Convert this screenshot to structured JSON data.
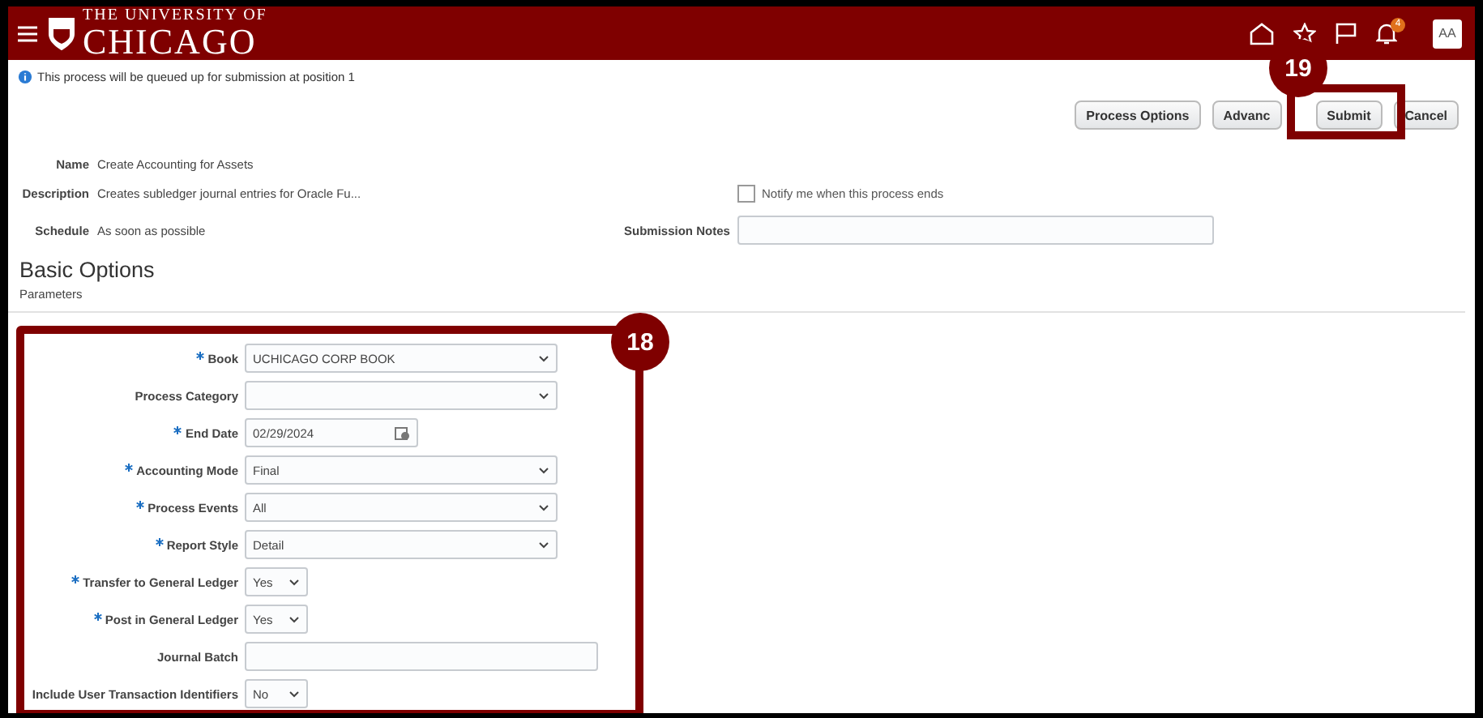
{
  "header": {
    "logo_top": "THE UNIVERSITY OF",
    "logo_main": "CHICAGO",
    "notification_count": "4",
    "avatar": "AA"
  },
  "info_message": "This process will be queued up for submission at position 1",
  "buttons": [
    {
      "label": "Process Options"
    },
    {
      "label": "Advanc"
    },
    {
      "label": "Submit"
    },
    {
      "label": "Cancel"
    }
  ],
  "details": [
    {
      "label": "Name",
      "value": "Create Accounting for Assets"
    },
    {
      "label": "Description",
      "value": "Creates subledger journal entries for Oracle Fu..."
    },
    {
      "label": "Schedule",
      "value": "As soon as possible"
    }
  ],
  "notify": {
    "label": "Notify me when this process ends",
    "checked": false
  },
  "submission_notes": {
    "label": "Submission Notes"
  },
  "section_title": "Basic Options",
  "subsection": "Parameters",
  "parameters": [
    {
      "label": "Book",
      "required": true,
      "kind": "select",
      "value": "UCHICAGO CORP BOOK"
    },
    {
      "label": "Process Category",
      "required": false,
      "kind": "select"
    },
    {
      "label": "End Date",
      "required": true,
      "kind": "date",
      "value": "02/29/2024"
    },
    {
      "label": "Accounting Mode",
      "required": true,
      "kind": "select",
      "value": "Final"
    },
    {
      "label": "Process Events",
      "required": true,
      "kind": "select",
      "value": "All"
    },
    {
      "label": "Report Style",
      "required": true,
      "kind": "select",
      "value": "Detail"
    },
    {
      "label": "Transfer to General Ledger",
      "required": true,
      "kind": "toggle",
      "value": "Yes"
    },
    {
      "label": "Post in General Ledger",
      "required": true,
      "kind": "toggle",
      "value": "Yes"
    },
    {
      "label": "Journal Batch",
      "required": false,
      "kind": "text"
    },
    {
      "label": "Include User Transaction Identifiers",
      "required": false,
      "kind": "toggle",
      "value": "No"
    }
  ],
  "callouts": [
    {
      "number": "18"
    },
    {
      "number": "19"
    }
  ]
}
